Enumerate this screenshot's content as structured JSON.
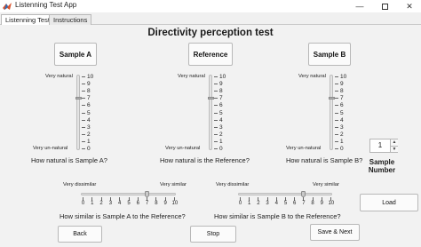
{
  "window": {
    "title": "Listenning Test App"
  },
  "tabs": [
    {
      "label": "Listenning Test"
    },
    {
      "label": "Instructions"
    }
  ],
  "main": {
    "title": "Directivity perception test",
    "sample_buttons": [
      {
        "label": "Sample A"
      },
      {
        "label": "Reference"
      },
      {
        "label": "Sample B"
      }
    ],
    "naturalness": {
      "top_label": "Very natural",
      "bottom_label": "Very un-natural",
      "scale": [
        "10",
        "9",
        "8",
        "7",
        "6",
        "5",
        "4",
        "3",
        "2",
        "1",
        "0"
      ],
      "sliders": [
        {
          "question": "How natural is Sample A?",
          "value": 7
        },
        {
          "question": "How natural is the Reference?",
          "value": 7
        },
        {
          "question": "How natural is Sample B?",
          "value": 7
        }
      ]
    },
    "similarity": {
      "left_label": "Very dissimilar",
      "right_label": "Very similar",
      "scale": [
        "0",
        "1",
        "2",
        "3",
        "4",
        "5",
        "6",
        "7",
        "8",
        "9",
        "10"
      ],
      "sliders": [
        {
          "question": "How  similar is Sample A to the Reference?",
          "value": 7
        },
        {
          "question": "How  similar is Sample B to the Reference?",
          "value": 7
        }
      ]
    },
    "sample_number": {
      "value": "1",
      "label_line1": "Sample",
      "label_line2": "Number"
    },
    "buttons": {
      "load": "Load",
      "back": "Back",
      "stop": "Stop",
      "save_next": "Save & Next"
    }
  }
}
